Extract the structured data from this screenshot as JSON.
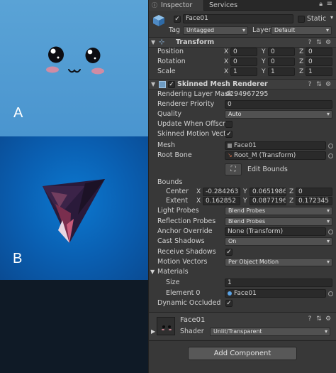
{
  "left": {
    "label_a": "A",
    "label_b": "B"
  },
  "tabs": {
    "inspector": "Inspector",
    "services": "Services"
  },
  "object": {
    "name": "Face01",
    "static_label": "Static",
    "tag_label": "Tag",
    "tag_value": "Untagged",
    "layer_label": "Layer",
    "layer_value": "Default"
  },
  "transform": {
    "title": "Transform",
    "position_label": "Position",
    "rotation_label": "Rotation",
    "scale_label": "Scale",
    "axis_x": "X",
    "axis_y": "Y",
    "axis_z": "Z",
    "position": [
      "0",
      "0",
      "0"
    ],
    "rotation": [
      "0",
      "0",
      "0"
    ],
    "scale": [
      "1",
      "1",
      "1"
    ]
  },
  "smr": {
    "title": "Skinned Mesh Renderer",
    "rendering_layer_mask_label": "Rendering Layer Mask",
    "rendering_layer_mask_value": "4294967295",
    "renderer_priority_label": "Renderer Priority",
    "renderer_priority_value": "0",
    "quality_label": "Quality",
    "quality_value": "Auto",
    "update_offscreen_label": "Update When Offscree",
    "skinned_motion_label": "Skinned Motion Vecto",
    "mesh_label": "Mesh",
    "mesh_value": "Face01",
    "root_bone_label": "Root Bone",
    "root_bone_value": "Root_M (Transform)",
    "edit_bounds_label": "Edit Bounds",
    "bounds_label": "Bounds",
    "center_label": "Center",
    "extent_label": "Extent",
    "center": [
      "-0.284263",
      "0.0651986",
      "0"
    ],
    "extent": [
      "0.162852",
      "0.0877196",
      "0.172345"
    ],
    "light_probes_label": "Light Probes",
    "light_probes_value": "Blend Probes",
    "reflection_probes_label": "Reflection Probes",
    "reflection_probes_value": "Blend Probes",
    "anchor_override_label": "Anchor Override",
    "anchor_override_value": "None (Transform)",
    "cast_shadows_label": "Cast Shadows",
    "cast_shadows_value": "On",
    "receive_shadows_label": "Receive Shadows",
    "motion_vectors_label": "Motion Vectors",
    "motion_vectors_value": "Per Object Motion",
    "materials_label": "Materials",
    "size_label": "Size",
    "size_value": "1",
    "element0_label": "Element 0",
    "element0_value": "Face01",
    "dynamic_occluded_label": "Dynamic Occluded",
    "check_mark": "✓"
  },
  "material": {
    "name": "Face01",
    "shader_label": "Shader",
    "shader_value": "Unlit/Transparent"
  },
  "add_component_label": "Add Component"
}
